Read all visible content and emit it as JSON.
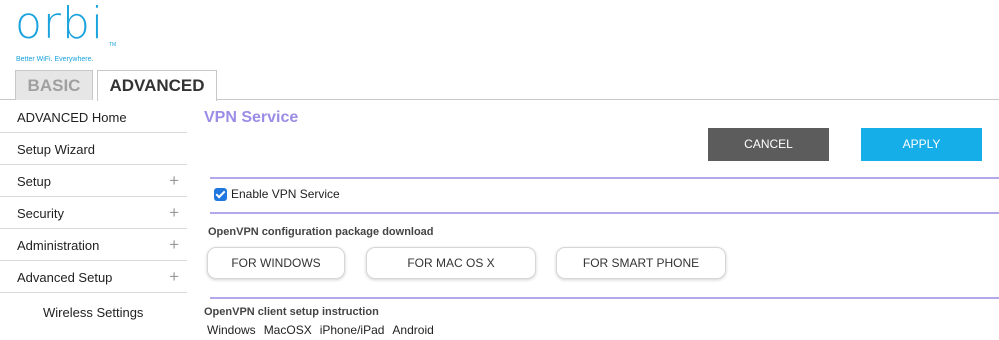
{
  "logo": {
    "word": "orbi",
    "tm": "TM",
    "tagline": "Better WiFi. Everywhere."
  },
  "tabs": [
    {
      "label": "BASIC"
    },
    {
      "label": "ADVANCED"
    }
  ],
  "sidebar": {
    "items": [
      {
        "label": "ADVANCED Home",
        "expandable": false
      },
      {
        "label": "Setup Wizard",
        "expandable": false
      },
      {
        "label": "Setup",
        "expandable": true
      },
      {
        "label": "Security",
        "expandable": true
      },
      {
        "label": "Administration",
        "expandable": true
      },
      {
        "label": "Advanced Setup",
        "expandable": true
      }
    ],
    "sub_item": {
      "label": "Wireless Settings"
    },
    "expand_glyph": "+"
  },
  "main": {
    "title": "VPN Service",
    "cancel_label": "CANCEL",
    "apply_label": "APPLY",
    "enable_label": "Enable VPN Service",
    "enable_checked": true,
    "download_heading": "OpenVPN configuration package download",
    "download_buttons": [
      {
        "label": "FOR WINDOWS"
      },
      {
        "label": "FOR MAC OS X"
      },
      {
        "label": "FOR SMART PHONE"
      }
    ],
    "instruction_heading": "OpenVPN client setup instruction",
    "instruction_links": [
      "Windows",
      "MacOSX",
      "iPhone/iPad",
      "Android"
    ]
  },
  "colors": {
    "brand": "#1aa3dd",
    "title": "#9b8ce6",
    "divider": "#b5a8ea",
    "cancel": "#5c5c5c",
    "apply": "#16aee8",
    "checkbox": "#1f77e0"
  }
}
